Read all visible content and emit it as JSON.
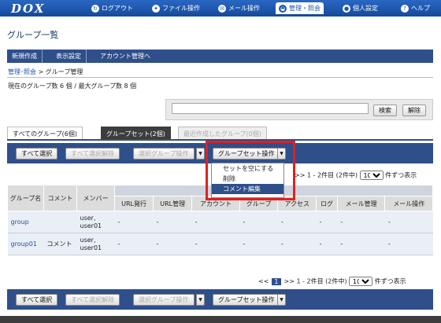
{
  "header": {
    "logo": "DOX",
    "nav": [
      {
        "label": "ログアウト",
        "icon": "logout-icon",
        "glyph": "↻"
      },
      {
        "label": "ファイル操作",
        "icon": "file-icon",
        "glyph": "✦"
      },
      {
        "label": "メール操作",
        "icon": "mail-icon",
        "glyph": "✉"
      },
      {
        "label": "管理・照会",
        "icon": "admin-icon",
        "glyph": "◒"
      },
      {
        "label": "個人設定",
        "icon": "user-icon",
        "glyph": "●"
      },
      {
        "label": "ヘルプ",
        "icon": "help-icon",
        "glyph": "?"
      }
    ]
  },
  "page_title": "グループ一覧",
  "menu": [
    "新規作成",
    "表示設定",
    "アカウント管理へ"
  ],
  "breadcrumb": {
    "link": "管理･照会",
    "sep": " > ",
    "current": "グループ管理"
  },
  "count_text": "現在のグループ数 6 個 / 最大グループ数 8 個",
  "search": {
    "value": "",
    "search_label": "検索",
    "clear_label": "解除"
  },
  "tabs": [
    "すべてのグループ(6個)",
    "グループセット(2個)",
    "最近作成したグループ(0個)"
  ],
  "toolbar": {
    "select_all": "すべて選択",
    "deselect_all": "すべて選択解除",
    "select_group_op": "選択グループ操作",
    "groupset_op": "グループセット操作"
  },
  "dropdown": {
    "items": [
      "セットを空にする",
      "削除",
      "コメント編集"
    ],
    "selected": "コメント編集"
  },
  "pager": {
    "prev": "<<",
    "page": "1",
    "next": ">>",
    "range": "1 - 2件目 (2件中)",
    "per_page": "10",
    "per_suffix": "件ずつ表示"
  },
  "table": {
    "headers": [
      "グループ名",
      "コメント",
      "メンバー",
      "URL発行",
      "URL管理",
      "アカウント",
      "グループ",
      "アクセス",
      "ログ",
      "メール管理",
      "メール操作"
    ],
    "rows": [
      {
        "name": "group",
        "comment": "",
        "members": "user, user01",
        "cells": [
          "-",
          "-",
          "-",
          "-",
          "-",
          "-",
          "-",
          "-"
        ]
      },
      {
        "name": "group01",
        "comment": "コメント",
        "members": "user, user01",
        "cells": [
          "-",
          "-",
          "-",
          "-",
          "-",
          "-",
          "-",
          "-"
        ]
      }
    ]
  }
}
